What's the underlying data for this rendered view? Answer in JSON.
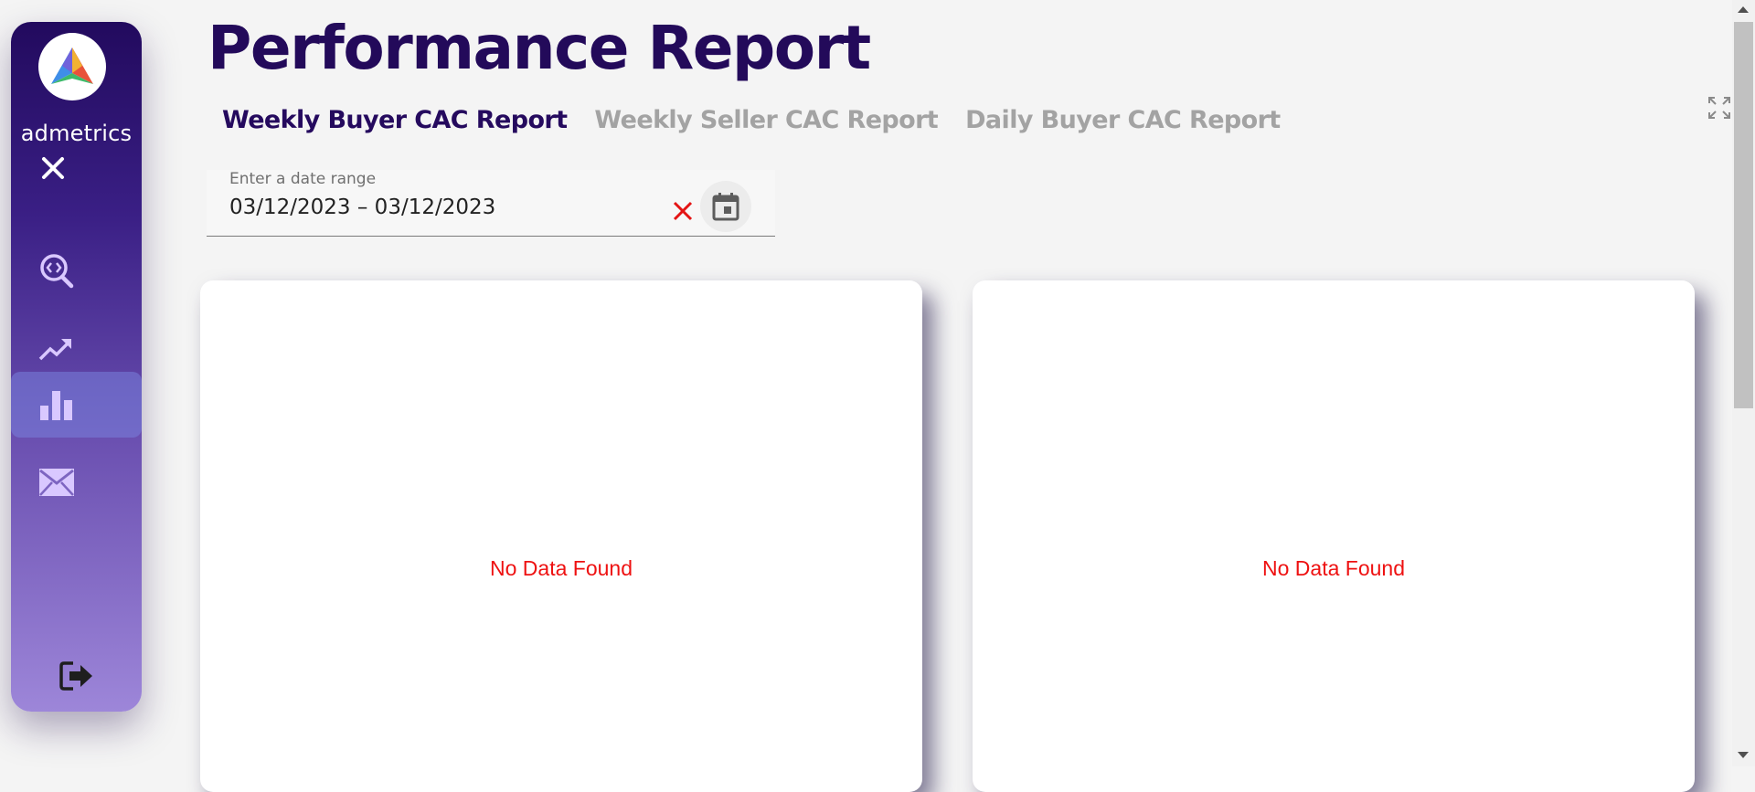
{
  "sidebar": {
    "logo_text": "admetrics",
    "items": [
      {
        "icon": "code-search-icon",
        "active": false
      },
      {
        "icon": "trending-up-icon",
        "active": false
      },
      {
        "icon": "bar-chart-icon",
        "active": true
      },
      {
        "icon": "mail-icon",
        "active": false
      }
    ],
    "close_icon": "close-icon",
    "logout_icon": "logout-icon"
  },
  "header": {
    "title": "Performance Report"
  },
  "tabs": [
    {
      "label": "Weekly Buyer CAC Report",
      "active": true
    },
    {
      "label": "Weekly Seller CAC Report",
      "active": false
    },
    {
      "label": "Daily Buyer CAC Report",
      "active": false
    }
  ],
  "date_range": {
    "label": "Enter a date range",
    "value": "03/12/2023 – 03/12/2023"
  },
  "panels": [
    {
      "message": "No Data Found"
    },
    {
      "message": "No Data Found"
    }
  ],
  "colors": {
    "title": "#230a5a",
    "active_tab": "#250a5e",
    "inactive_tab": "#a3a3a3",
    "no_data": "#ee1111",
    "sidebar_top": "#220a5e",
    "sidebar_bottom": "#9d86d9",
    "icon": "#d9c8ff"
  }
}
